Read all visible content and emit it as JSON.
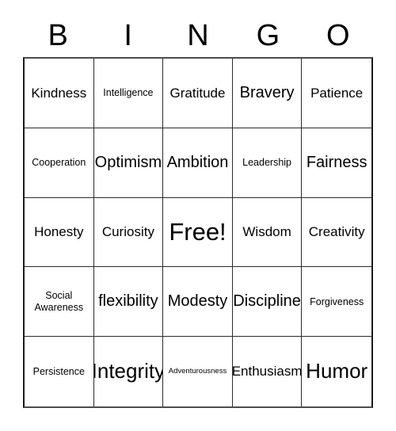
{
  "card": {
    "title_letters": [
      "B",
      "I",
      "N",
      "G",
      "O"
    ],
    "columns": 5,
    "rows": 5,
    "free_space_label": "Free!",
    "colors": {
      "background": "#ffffff",
      "text": "#000000",
      "grid_line": "#2b2b2b",
      "outer_border": "#1a1a1a"
    },
    "cells": [
      {
        "text": "Kindness",
        "size": "md"
      },
      {
        "text": "Intelligence",
        "size": "sm"
      },
      {
        "text": "Gratitude",
        "size": "md"
      },
      {
        "text": "Bravery",
        "size": "lg"
      },
      {
        "text": "Patience",
        "size": "md"
      },
      {
        "text": "Cooperation",
        "size": "sm"
      },
      {
        "text": "Optimism",
        "size": "lg"
      },
      {
        "text": "Ambition",
        "size": "lg"
      },
      {
        "text": "Leadership",
        "size": "sm"
      },
      {
        "text": "Fairness",
        "size": "lg"
      },
      {
        "text": "Honesty",
        "size": "md"
      },
      {
        "text": "Curiosity",
        "size": "md"
      },
      {
        "text": "Free!",
        "size": "xxl"
      },
      {
        "text": "Wisdom",
        "size": "md"
      },
      {
        "text": "Creativity",
        "size": "md"
      },
      {
        "text": "Social\nAwareness",
        "size": "sm"
      },
      {
        "text": "flexibility",
        "size": "lg"
      },
      {
        "text": "Modesty",
        "size": "lg"
      },
      {
        "text": "Discipline",
        "size": "lg"
      },
      {
        "text": "Forgiveness",
        "size": "sm"
      },
      {
        "text": "Persistence",
        "size": "sm"
      },
      {
        "text": "Integrity",
        "size": "xl"
      },
      {
        "text": "Adventurousness",
        "size": "xs"
      },
      {
        "text": "Enthusiasm",
        "size": "md"
      },
      {
        "text": "Humor",
        "size": "xl"
      }
    ]
  }
}
